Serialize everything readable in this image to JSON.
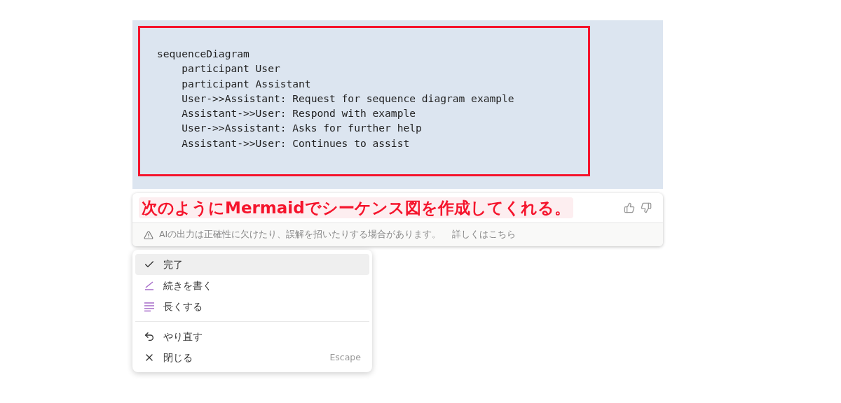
{
  "code_block": {
    "lines": [
      "sequenceDiagram",
      "    participant User",
      "    participant Assistant",
      "    User->>Assistant: Request for sequence diagram example",
      "    Assistant->>User: Respond with example",
      "    User->>Assistant: Asks for further help",
      "    Assistant->>User: Continues to assist"
    ]
  },
  "response": {
    "text": "次のようにMermaidでシーケンス図を作成してくれる。",
    "disclaimer": "AIの出力は正確性に欠けたり、誤解を招いたりする場合があります。",
    "link": "詳しくはこちら"
  },
  "menu": {
    "groups": [
      {
        "items": [
          {
            "kind": "check",
            "label": "完了",
            "selected": true
          },
          {
            "kind": "pen",
            "label": "続きを書く",
            "selected": false
          },
          {
            "kind": "lines",
            "label": "長くする",
            "selected": false
          }
        ]
      },
      {
        "items": [
          {
            "kind": "undo",
            "label": "やり直す",
            "selected": false
          },
          {
            "kind": "close",
            "label": "閉じる",
            "shortcut": "Escape",
            "selected": false
          }
        ]
      }
    ]
  }
}
